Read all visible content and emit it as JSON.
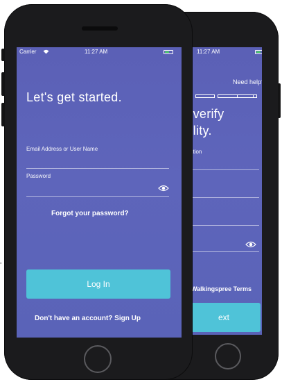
{
  "back_phone": {
    "status": {
      "time": "11:27 AM"
    },
    "help_link": "Need help?",
    "title_line1": "s verify",
    "title_line2": "bility.",
    "field_label_partial": "cation",
    "terms_text": "Walkingspree Terms",
    "next_button": "ext"
  },
  "front_phone": {
    "status": {
      "carrier": "Carrier",
      "time": "11:27 AM"
    },
    "title": "Let's get started.",
    "email_label": "Email Address or User Name",
    "password_label": "Password",
    "forgot_link": "Forgot your password?",
    "login_button": "Log In",
    "signup_prompt": "Don't have an account? Sign Up"
  },
  "colors": {
    "screen_bg": "#5b60b6",
    "button_bg": "#4fc3d8",
    "phone_body": "#1b1b1d"
  }
}
